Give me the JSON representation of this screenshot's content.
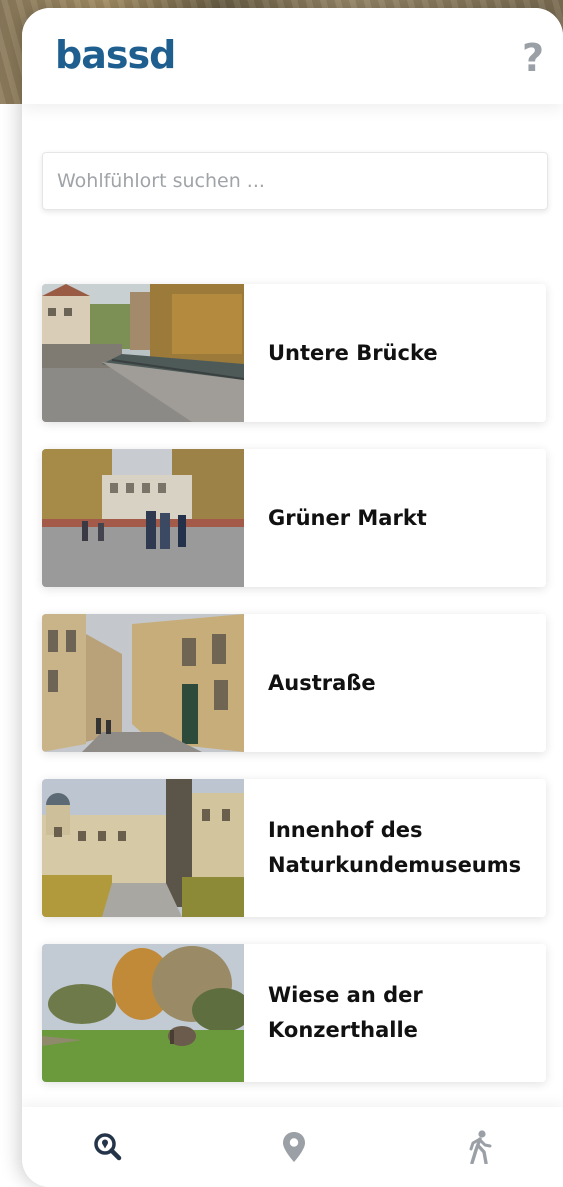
{
  "header": {
    "logo": "bassd",
    "help_label": "?"
  },
  "search": {
    "placeholder": "Wohlfühlort suchen ...",
    "value": ""
  },
  "places": [
    {
      "title": "Untere Brücke"
    },
    {
      "title": "Grüner Markt"
    },
    {
      "title": "Austraße"
    },
    {
      "title": "Innenhof des Naturkundemuseums"
    },
    {
      "title": "Wiese an der Konzerthalle"
    }
  ],
  "nav": {
    "items": [
      {
        "icon": "search-location-icon",
        "active": true
      },
      {
        "icon": "map-pin-icon",
        "active": false
      },
      {
        "icon": "walking-person-icon",
        "active": false
      }
    ]
  },
  "colors": {
    "brand": "#1f5f8f",
    "nav_active": "#24354a",
    "nav_inactive": "#9aa0a6"
  }
}
